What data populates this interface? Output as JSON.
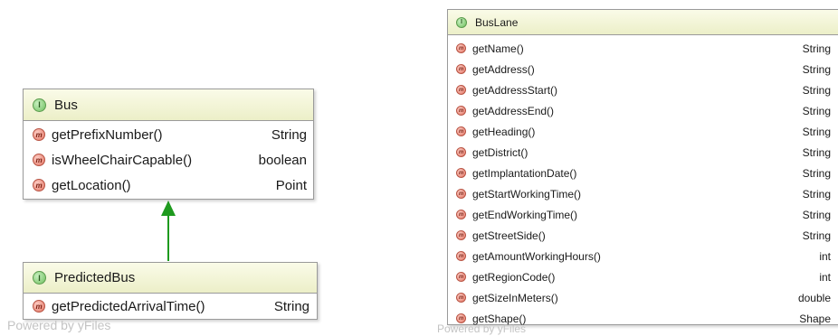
{
  "bus": {
    "badge": "I",
    "title": "Bus",
    "members": [
      {
        "badge": "m",
        "name": "getPrefixNumber()",
        "type": "String"
      },
      {
        "badge": "m",
        "name": "isWheelChairCapable()",
        "type": "boolean"
      },
      {
        "badge": "m",
        "name": "getLocation()",
        "type": "Point"
      }
    ]
  },
  "predicted_bus": {
    "badge": "I",
    "title": "PredictedBus",
    "members": [
      {
        "badge": "m",
        "name": "getPredictedArrivalTime()",
        "type": "String"
      }
    ]
  },
  "bus_lane": {
    "badge": "I",
    "title": "BusLane",
    "members": [
      {
        "badge": "m",
        "name": "getName()",
        "type": "String"
      },
      {
        "badge": "m",
        "name": "getAddress()",
        "type": "String"
      },
      {
        "badge": "m",
        "name": "getAddressStart()",
        "type": "String"
      },
      {
        "badge": "m",
        "name": "getAddressEnd()",
        "type": "String"
      },
      {
        "badge": "m",
        "name": "getHeading()",
        "type": "String"
      },
      {
        "badge": "m",
        "name": "getDistrict()",
        "type": "String"
      },
      {
        "badge": "m",
        "name": "getImplantationDate()",
        "type": "String"
      },
      {
        "badge": "m",
        "name": "getStartWorkingTime()",
        "type": "String"
      },
      {
        "badge": "m",
        "name": "getEndWorkingTime()",
        "type": "String"
      },
      {
        "badge": "m",
        "name": "getStreetSide()",
        "type": "String"
      },
      {
        "badge": "m",
        "name": "getAmountWorkingHours()",
        "type": "int"
      },
      {
        "badge": "m",
        "name": "getRegionCode()",
        "type": "int"
      },
      {
        "badge": "m",
        "name": "getSizeInMeters()",
        "type": "double"
      },
      {
        "badge": "m",
        "name": "getShape()",
        "type": "Shape"
      }
    ]
  },
  "watermarks": {
    "left": "Powered by yFiles",
    "right": "Powered by yFiles"
  },
  "colors": {
    "inheritance_arrow": "#1e9a1e",
    "header_bg": "#eef0cc",
    "interface_badge": "#6fbf5e",
    "method_badge": "#e0705e"
  }
}
